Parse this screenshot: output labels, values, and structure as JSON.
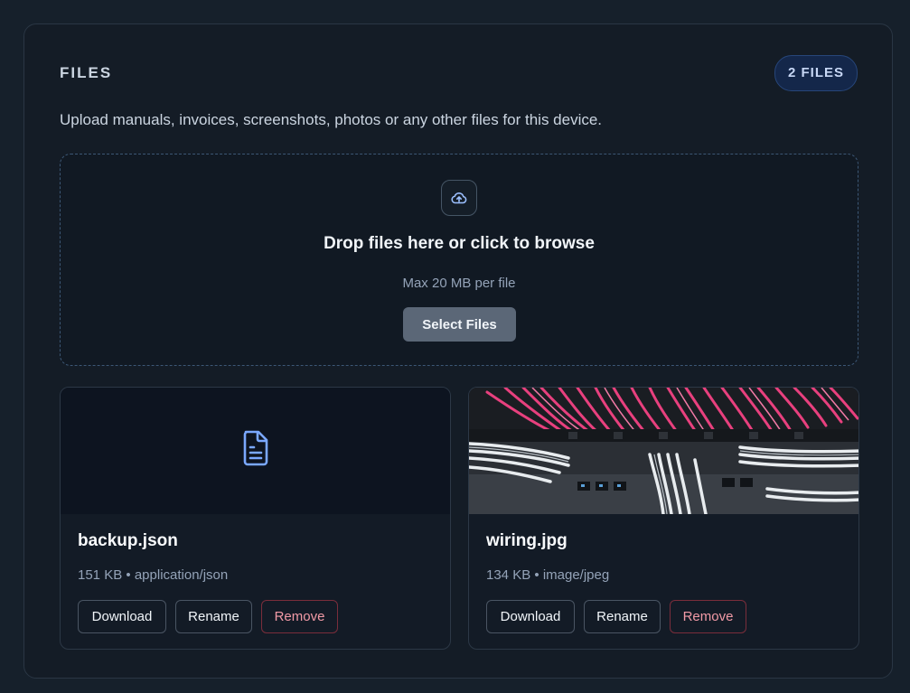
{
  "section": {
    "title": "FILES",
    "count_badge": "2 FILES",
    "description": "Upload manuals, invoices, screenshots, photos or any other files for this device."
  },
  "dropzone": {
    "icon": "cloud-upload-icon",
    "title": "Drop files here or click to browse",
    "subtitle": "Max 20 MB per file",
    "button_label": "Select Files"
  },
  "files": [
    {
      "name": "backup.json",
      "size": "151 KB",
      "separator": "•",
      "type": "application/json",
      "preview_icon": "file-text-icon",
      "actions": {
        "download": "Download",
        "rename": "Rename",
        "remove": "Remove"
      }
    },
    {
      "name": "wiring.jpg",
      "size": "134 KB",
      "separator": "•",
      "type": "image/jpeg",
      "preview": "photo of pink and white network cables in a rack",
      "actions": {
        "download": "Download",
        "rename": "Rename",
        "remove": "Remove"
      }
    }
  ],
  "colors": {
    "accent": "#7aa8ff",
    "remove": "#f19aa6",
    "cable_pink": "#e8407e",
    "cable_white": "#e8ecef"
  }
}
